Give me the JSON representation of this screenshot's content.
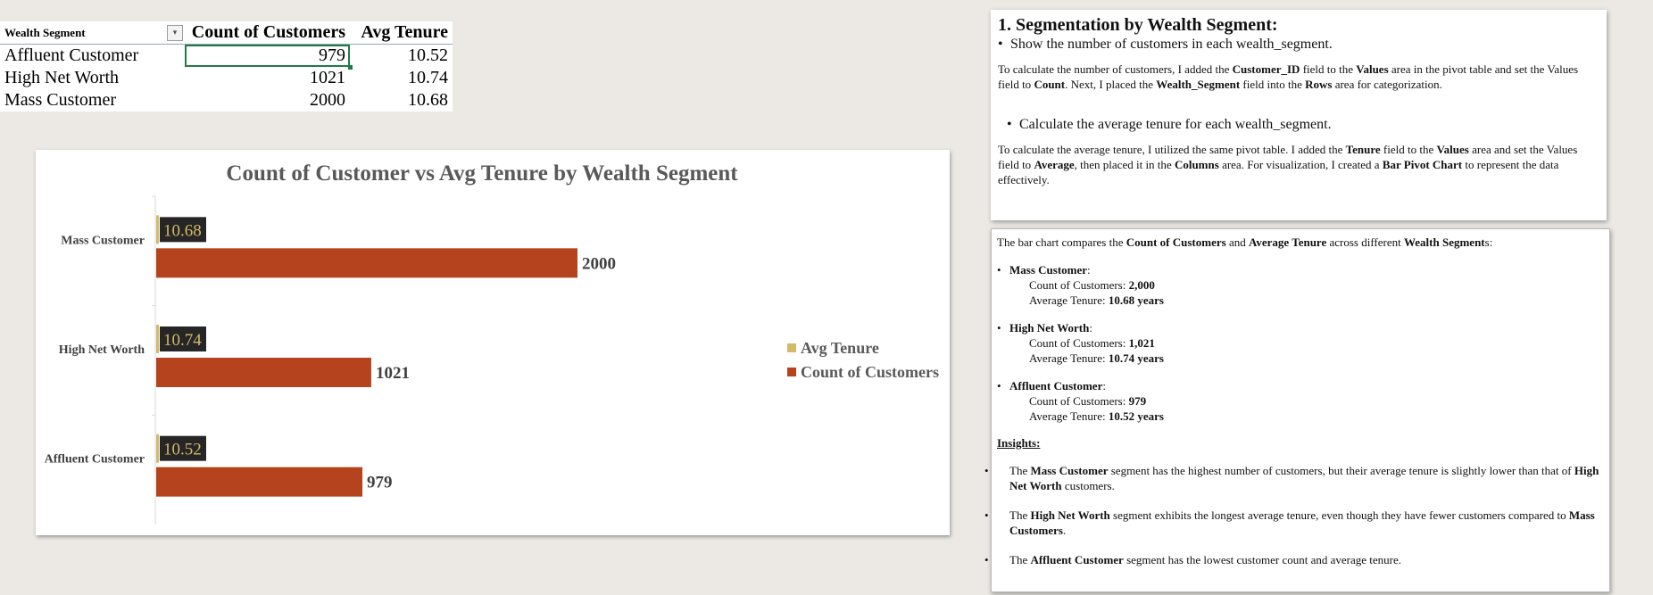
{
  "pivot": {
    "headers": [
      "Wealth Segment",
      "Count of Customers",
      "Avg Tenure"
    ],
    "rows": [
      {
        "segment": "Affluent Customer",
        "count": "979",
        "tenure": "10.52"
      },
      {
        "segment": "High Net Worth",
        "count": "1021",
        "tenure": "10.74"
      },
      {
        "segment": "Mass Customer",
        "count": "2000",
        "tenure": "10.68"
      }
    ]
  },
  "chart_data": {
    "type": "bar",
    "orientation": "horizontal",
    "title": "Count of Customer vs Avg Tenure by Wealth Segment",
    "categories": [
      "Mass Customer",
      "High Net Worth",
      "Affluent Customer"
    ],
    "series": [
      {
        "name": "Avg Tenure",
        "values": [
          10.68,
          10.74,
          10.52
        ],
        "color": "#d3b96a",
        "labels": [
          "10.68",
          "10.74",
          "10.52"
        ]
      },
      {
        "name": "Count of Customers",
        "values": [
          2000,
          1021,
          979
        ],
        "color": "#b5441e",
        "labels": [
          "2000",
          "1021",
          "979"
        ]
      }
    ],
    "xlim": [
      0,
      2500
    ],
    "legend": "right",
    "grid": false
  },
  "box1": {
    "title": "1. Segmentation by Wealth Segment:",
    "bullet1": "Show the number of customers in each wealth_segment.",
    "p1": [
      {
        "t": "To calculate the number of customers, I added the "
      },
      {
        "t": "Customer_ID",
        "b": true
      },
      {
        "t": " field to the "
      },
      {
        "t": "Values",
        "b": true
      },
      {
        "t": " area in the pivot table and set the Values field to "
      },
      {
        "t": "Count",
        "b": true
      },
      {
        "t": ". Next, I placed the "
      },
      {
        "t": "Wealth_Segment",
        "b": true
      },
      {
        "t": " field into the "
      },
      {
        "t": "Rows",
        "b": true
      },
      {
        "t": " area for categorization."
      }
    ],
    "bullet2": "Calculate the average tenure for each wealth_segment.",
    "p2": [
      {
        "t": "To calculate the average tenure, I utilized the same pivot table. I added the "
      },
      {
        "t": "Tenure",
        "b": true
      },
      {
        "t": " field to the "
      },
      {
        "t": "Values",
        "b": true
      },
      {
        "t": " area and set the Values field to "
      },
      {
        "t": "Average",
        "b": true
      },
      {
        "t": ", then placed it in the "
      },
      {
        "t": "Columns",
        "b": true
      },
      {
        "t": " area. For visualization, I created a "
      },
      {
        "t": "Bar Pivot Chart",
        "b": true
      },
      {
        "t": " to represent the data effectively."
      }
    ]
  },
  "box2": {
    "intro": [
      {
        "t": "The bar chart compares the "
      },
      {
        "t": "Count of Customers",
        "b": true
      },
      {
        "t": " and "
      },
      {
        "t": "Average Tenure",
        "b": true
      },
      {
        "t": " across different "
      },
      {
        "t": "Wealth Segment",
        "b": true
      },
      {
        "t": "s:"
      }
    ],
    "segments": [
      {
        "name": "Mass Customer",
        "count_label": "Count of Customers: ",
        "count": "2,000",
        "tenure_label": "Average Tenure: ",
        "tenure": "10.68 years"
      },
      {
        "name": "High Net Worth",
        "count_label": "Count of Customers: ",
        "count": "1,021",
        "tenure_label": "Average Tenure: ",
        "tenure": "10.74 years"
      },
      {
        "name": "Affluent Customer",
        "count_label": "Count of Customers: ",
        "count": "979",
        "tenure_label": "Average Tenure: ",
        "tenure": "10.52 years"
      }
    ],
    "insights_title": "Insights:",
    "insights": [
      [
        {
          "t": "The "
        },
        {
          "t": "Mass Customer",
          "b": true
        },
        {
          "t": " segment has the highest number of customers, but their average tenure is slightly lower than that of "
        },
        {
          "t": "High Net Worth",
          "b": true
        },
        {
          "t": " customers."
        }
      ],
      [
        {
          "t": "The "
        },
        {
          "t": "High Net Worth",
          "b": true
        },
        {
          "t": " segment exhibits the longest average tenure, even though they have fewer customers compared to "
        },
        {
          "t": "Mass Customers",
          "b": true
        },
        {
          "t": "."
        }
      ],
      [
        {
          "t": "The "
        },
        {
          "t": "Affluent Customer",
          "b": true
        },
        {
          "t": " segment has the lowest customer count and average tenure."
        }
      ]
    ]
  }
}
